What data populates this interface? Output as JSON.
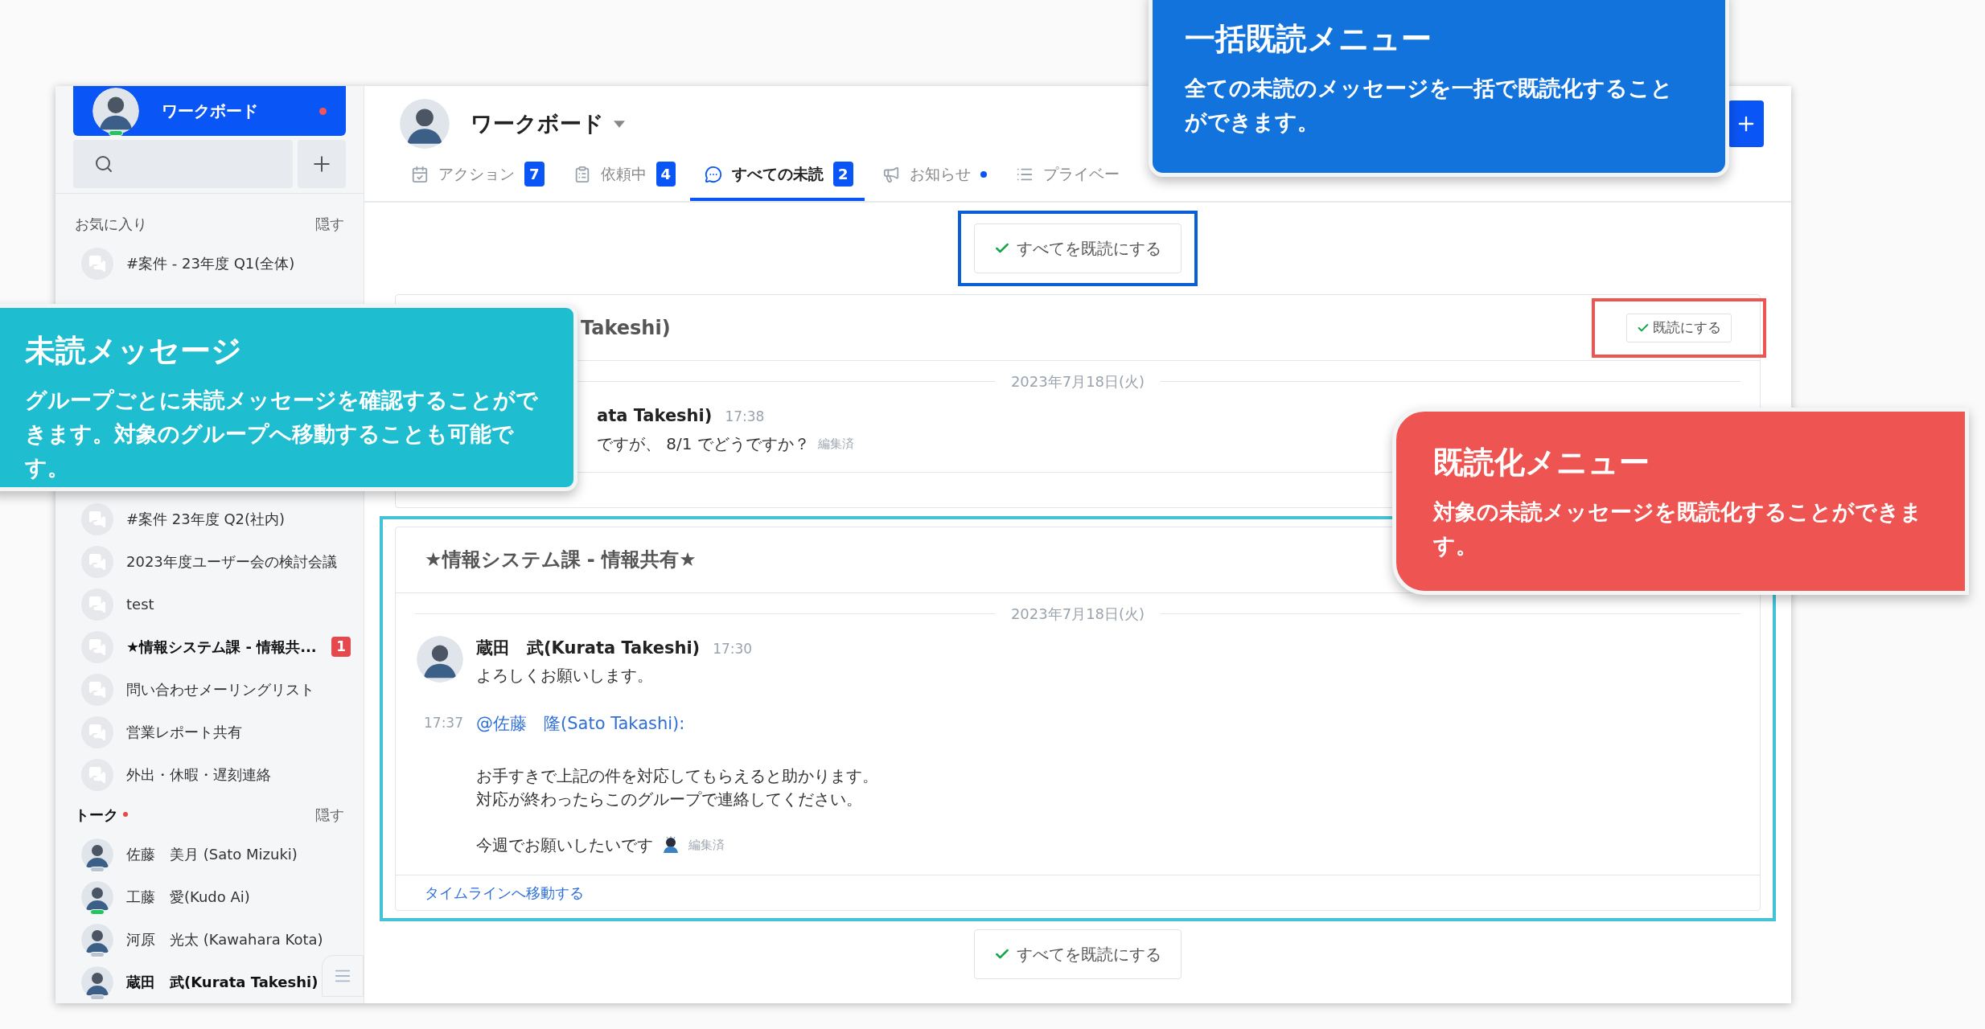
{
  "sidebar": {
    "workspace": {
      "name": "ワークボード",
      "notification": true,
      "online": true
    },
    "sections": [
      {
        "title": "お気に入り",
        "hide": "隠す",
        "dot": false,
        "items": [
          {
            "kind": "group",
            "name": "#案件 - 23年度 Q1(全体)",
            "unread": false
          },
          {
            "kind": "group",
            "name": "#案件 23年度 Q2(社内)",
            "unread": false
          },
          {
            "kind": "group",
            "name": "2023年度ユーザー会の検討会議",
            "unread": false
          },
          {
            "kind": "group",
            "name": "test",
            "unread": false
          },
          {
            "kind": "group",
            "name": "★情報システム課 - 情報共...",
            "unread": true,
            "badge": "1"
          },
          {
            "kind": "group",
            "name": "問い合わせメーリングリスト",
            "unread": false
          },
          {
            "kind": "group",
            "name": "営業レポート共有",
            "unread": false
          },
          {
            "kind": "group",
            "name": "外出・休暇・遅刻連絡",
            "unread": false
          }
        ]
      },
      {
        "title": "トーク",
        "hide": "隠す",
        "dot": true,
        "items": [
          {
            "kind": "person",
            "name": "佐藤　美月 (Sato Mizuki)",
            "unread": false,
            "online": false
          },
          {
            "kind": "person",
            "name": "工藤　愛(Kudo Ai)",
            "unread": false,
            "online": true
          },
          {
            "kind": "person",
            "name": "河原　光太 (Kawahara Kota)",
            "unread": false,
            "online": false
          },
          {
            "kind": "person",
            "name": "蔵田　武(Kurata Takeshi)",
            "unread": true,
            "online": false
          }
        ]
      }
    ]
  },
  "header": {
    "title": "ワークボード",
    "tabs": [
      {
        "kind": "calendar",
        "label": "アクション",
        "badge": "7",
        "selected": false
      },
      {
        "kind": "clipboard",
        "label": "依頼中",
        "badge": "4",
        "selected": false
      },
      {
        "kind": "chat",
        "label": "すべての未読",
        "badge": "2",
        "selected": true
      },
      {
        "kind": "megaphone",
        "label": "お知らせ",
        "dot": true,
        "selected": false
      },
      {
        "kind": "list",
        "label": "プライベー",
        "selected": false
      }
    ]
  },
  "mark_all_top": "すべてを既読にする",
  "cards": [
    {
      "title": "Takeshi)",
      "mark_read": "既読にする",
      "date": "2023年7月18日(火)",
      "messages": [
        {
          "author": "ata Takeshi)",
          "time": "17:38",
          "paragraphs": [
            [
              "ですが、 8/1 でどうですか？"
            ]
          ],
          "edited": "編集済"
        }
      ]
    },
    {
      "title": "★情報システム課 - 情報共有★",
      "date": "2023年7月18日(火)",
      "messages": [
        {
          "author": "蔵田　武(Kurata Takeshi)",
          "time": "17:30",
          "paragraphs": [
            [
              "よろしくお願いします。"
            ]
          ]
        },
        {
          "time": "17:37",
          "mention": "@佐藤　隆(Sato Takashi):",
          "paragraphs": [
            [
              "お手すきで上記の件を対応してもらえると助かります。",
              "対応が終わったらこのグループで連絡してください。"
            ],
            [
              "今週でお願いしたいです"
            ]
          ],
          "edited": "編集済"
        }
      ],
      "link": "タイムラインへ移動する"
    }
  ],
  "mark_all_bottom": "すべてを既読にする",
  "callouts": [
    {
      "title": "一括既読メニュー",
      "body": "全ての未読のメッセージを一括で既読化することができます。",
      "color": "#1273dc"
    },
    {
      "title": "未読メッセージ",
      "body": "グループごとに未読メッセージを確認することができます。対象のグループへ移動することも可能です。",
      "color": "#1fbdd0"
    },
    {
      "title": "既読化メニュー",
      "body": "対象の未読メッセージを既読化することができます。",
      "color": "#ee5552"
    }
  ]
}
